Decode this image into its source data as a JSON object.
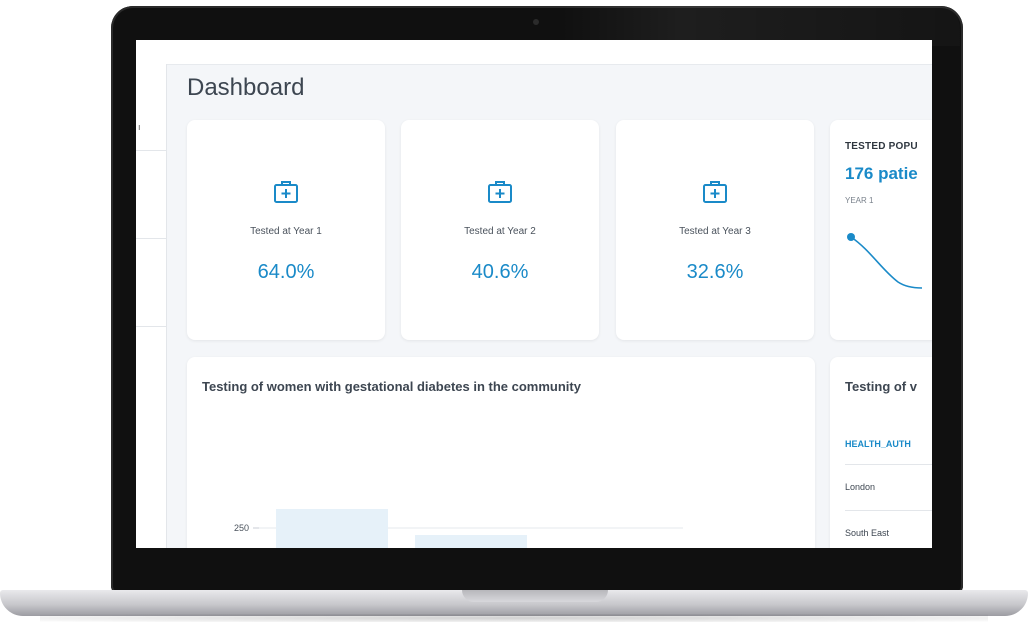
{
  "page": {
    "title": "Dashboard"
  },
  "stats": [
    {
      "label": "Tested at Year 1",
      "value": "64.0%",
      "icon": "medical-kit-icon"
    },
    {
      "label": "Tested at Year 2",
      "value": "40.6%",
      "icon": "medical-kit-icon"
    },
    {
      "label": "Tested at Year 3",
      "value": "32.6%",
      "icon": "medical-kit-icon"
    }
  ],
  "population": {
    "title": "TESTED POPU",
    "value": "176 patie",
    "period": "YEAR 1"
  },
  "chart": {
    "title": "Testing of women with gestational diabetes in the community"
  },
  "chart_data": {
    "type": "bar",
    "title": "Testing of women with gestational diabetes in the community",
    "ytick_visible": "250",
    "categories": [],
    "values": []
  },
  "table": {
    "title": "Testing of v",
    "header": "HEALTH_AUTH",
    "rows": [
      "London",
      "South East"
    ]
  },
  "sidebar": {
    "mark": "ı"
  },
  "colors": {
    "accent": "#1a8ac8",
    "background": "#f4f6f9",
    "card": "#ffffff"
  }
}
